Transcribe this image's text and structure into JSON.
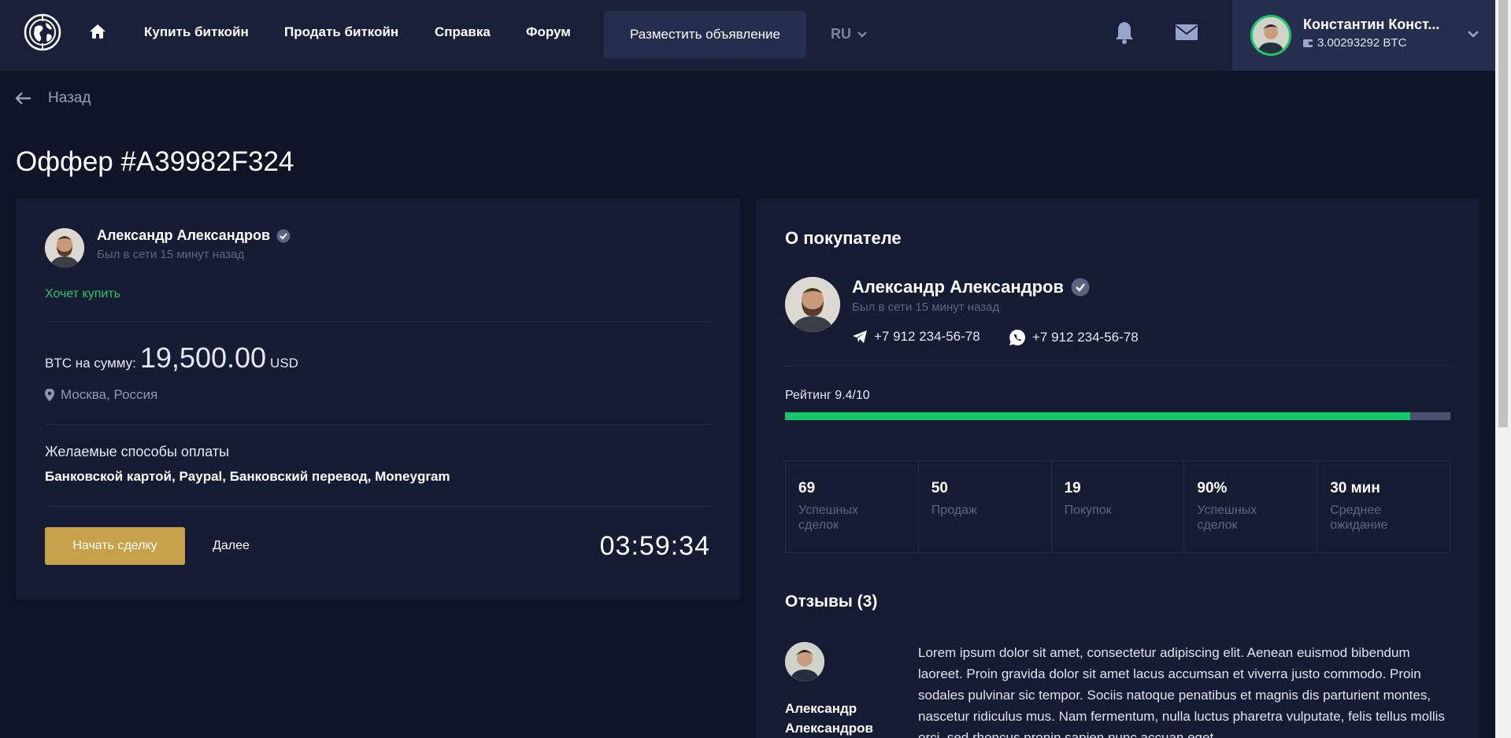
{
  "nav": {
    "links": [
      "Купить биткойн",
      "Продать биткойн",
      "Справка",
      "Форум"
    ],
    "post_ad": "Разместить объявление",
    "lang": "RU"
  },
  "user": {
    "name": "Константин Конст...",
    "balance": "3.00293292 BTC"
  },
  "page": {
    "back": "Назад",
    "title": "Оффер #A39982F324"
  },
  "offer": {
    "seller_name": "Александр Александров",
    "seller_status": "Был в сети 15 минут назад",
    "intent": "Хочет купить",
    "amount_label": "BTC на сумму:",
    "amount": "19,500.00",
    "currency": "USD",
    "location": "Москва, Россия",
    "payment_title": "Желаемые способы оплаты",
    "payment_methods": "Банковской картой, Paypal, Банковский перевод, Moneygram",
    "start_button": "Начать сделку",
    "next_link": "Далее",
    "timer": "03:59:34"
  },
  "buyer": {
    "section_title": "О покупателе",
    "name": "Александр Александров",
    "status": "Был в сети 15 минут назад",
    "telegram": "+7 912 234-56-78",
    "whatsapp": "+7 912 234-56-78",
    "rating_label": "Рейтинг 9.4/10",
    "rating_fraction": 0.94,
    "stats": [
      {
        "value": "69",
        "label": "Успешных сделок"
      },
      {
        "value": "50",
        "label": "Продаж"
      },
      {
        "value": "19",
        "label": "Покупок"
      },
      {
        "value": "90%",
        "label": "Успешных сделок"
      },
      {
        "value": "30 мин",
        "label": "Среднее ожидание"
      }
    ]
  },
  "reviews": {
    "title": "Отзывы (3)",
    "items": [
      {
        "author": "Александр Александров",
        "text": "Lorem ipsum dolor sit amet, consectetur adipiscing elit. Aenean euismod bibendum laoreet. Proin gravida dolor sit amet lacus accumsan et viverra justo commodo. Proin sodales pulvinar sic tempor. Sociis natoque penatibus et magnis dis parturient montes, nascetur ridiculus mus. Nam fermentum, nulla luctus pharetra vulputate, felis tellus mollis orci, sed rhoncus pronin sapien nunc accuan eget."
      }
    ]
  },
  "colors": {
    "accent_gold": "#c7a14a",
    "success_green": "#22c766",
    "background": "#0f1427",
    "card": "#161c33"
  }
}
